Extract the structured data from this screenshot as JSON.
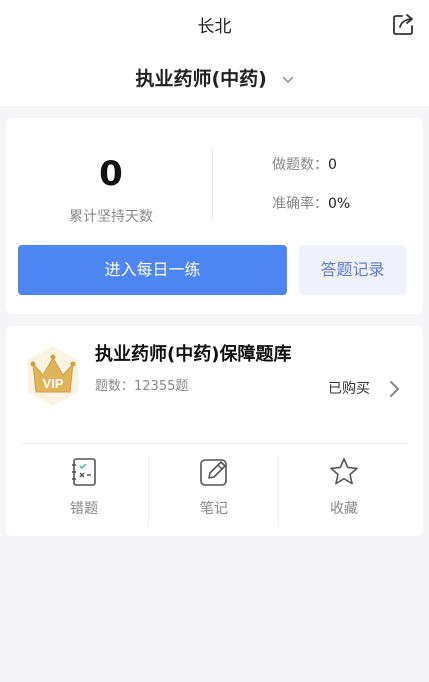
{
  "header": {
    "title": "长北",
    "exam_name": "执业药师(中药)"
  },
  "stats": {
    "days_value": "0",
    "days_label": "累计坚持天数",
    "answered_label": "做题数：",
    "answered_value": "0",
    "accuracy_label": "准确率：",
    "accuracy_value": "0%"
  },
  "actions": {
    "daily_practice": "进入每日一练",
    "history": "答题记录"
  },
  "bank": {
    "badge_text": "VIP",
    "title": "执业药师(中药)保障题库",
    "count": "题数：12355题",
    "status": "已购买"
  },
  "tools": [
    {
      "label": "错题"
    },
    {
      "label": "笔记"
    },
    {
      "label": "收藏"
    }
  ],
  "colors": {
    "primary": "#4e86f1",
    "secondary_bg": "#eff2fb",
    "secondary_text": "#5b7be0",
    "vip_gold": "#e0b45a"
  }
}
